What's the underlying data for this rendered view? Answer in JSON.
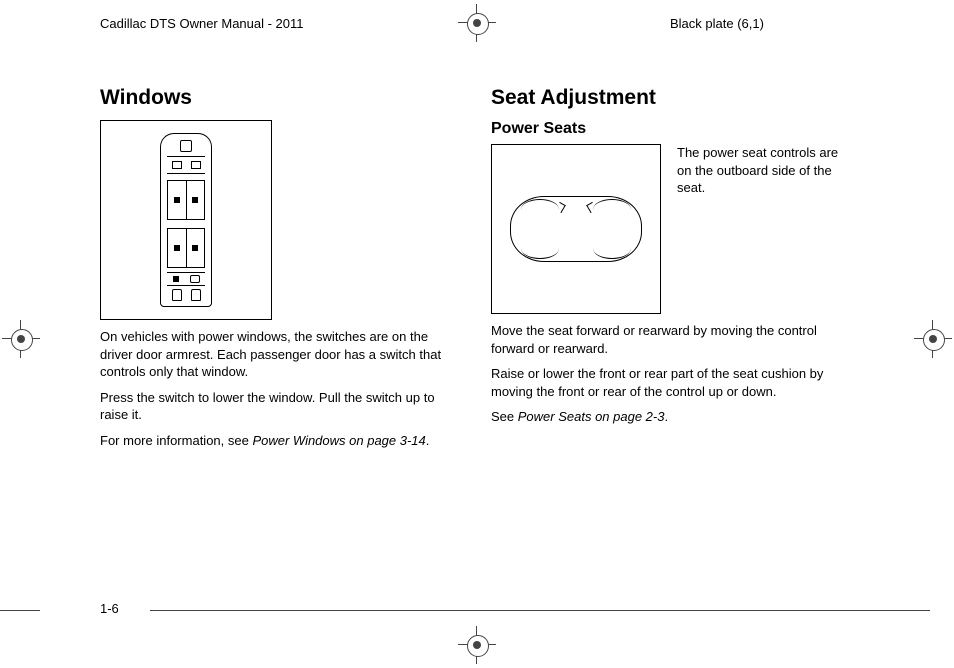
{
  "header": {
    "manual_title": "Cadillac DTS Owner Manual - 2011",
    "plate_label": "Black plate (6,1)"
  },
  "page_number": "1-6",
  "windows": {
    "heading": "Windows",
    "para1": "On vehicles with power windows, the switches are on the driver door armrest. Each passenger door has a switch that controls only that window.",
    "para2": "Press the switch to lower the window. Pull the switch up to raise it.",
    "para3_lead": "For more information, see ",
    "para3_ref": "Power Windows on page 3-14",
    "para3_tail": "."
  },
  "seat": {
    "heading": "Seat Adjustment",
    "subheading": "Power Seats",
    "intro": "The power seat controls are on the outboard side of the seat.",
    "para1": "Move the seat forward or rearward by moving the control forward or rearward.",
    "para2": "Raise or lower the front or rear part of the seat cushion by moving the front or rear of the control up or down.",
    "para3_lead": "See ",
    "para3_ref": "Power Seats on page 2-3",
    "para3_tail": "."
  }
}
